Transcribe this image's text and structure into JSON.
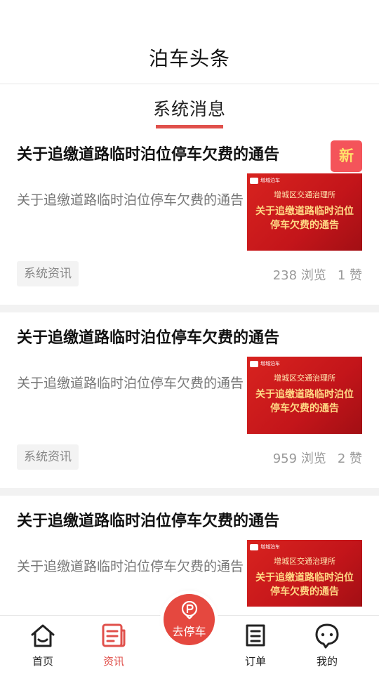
{
  "header": {
    "title": "泊车头条"
  },
  "tabs": {
    "active_label": "系统消息"
  },
  "articles": [
    {
      "title": "关于追缴道路临时泊位停车欠费的通告",
      "summary": "关于追缴道路临时泊位停车欠费的通告",
      "tag": "系统资讯",
      "views": "238 浏览",
      "likes": "1 赞",
      "badge": "新",
      "thumb": {
        "brand": "增城泊车",
        "org": "增城区交通治理所",
        "line1": "关于追缴道路临时泊位",
        "line2": "停车欠费的通告"
      }
    },
    {
      "title": "关于追缴道路临时泊位停车欠费的通告",
      "summary": "关于追缴道路临时泊位停车欠费的通告",
      "tag": "系统资讯",
      "views": "959 浏览",
      "likes": "2 赞",
      "thumb": {
        "brand": "增城泊车",
        "org": "增城区交通治理所",
        "line1": "关于追缴道路临时泊位",
        "line2": "停车欠费的通告"
      }
    },
    {
      "title": "关于追缴道路临时泊位停车欠费的通告",
      "summary": "关于追缴道路临时泊位停车欠费的通告",
      "thumb": {
        "brand": "增城泊车",
        "org": "增城区交通治理所",
        "line1": "关于追缴道路临时泊位",
        "line2": "停车欠费的通告"
      }
    }
  ],
  "bottom_nav": {
    "home": "首页",
    "news": "资讯",
    "park": "去停车",
    "orders": "订单",
    "mine": "我的"
  },
  "colors": {
    "accent": "#e0504b",
    "badge_bg": "#f4545a",
    "badge_text": "#ffe16a",
    "fab": "#e5483f"
  },
  "icons": [
    "house-icon",
    "news-icon",
    "parking-pin-icon",
    "order-list-icon",
    "chat-face-icon"
  ]
}
